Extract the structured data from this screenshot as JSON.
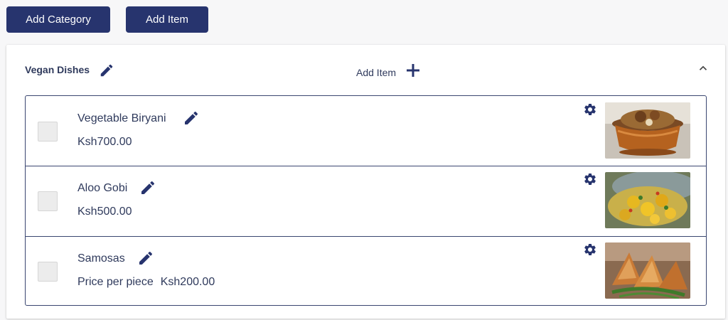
{
  "toolbar": {
    "add_category_label": "Add Category",
    "add_item_label": "Add Item"
  },
  "category": {
    "title": "Vegan Dishes",
    "add_item_label": "Add Item"
  },
  "items": [
    {
      "name": "Vegetable Biryani",
      "price_prefix": "",
      "price": "Ksh700.00",
      "image": "vegetable-biryani-photo"
    },
    {
      "name": "Aloo Gobi",
      "price_prefix": "",
      "price": "Ksh500.00",
      "image": "aloo-gobi-photo"
    },
    {
      "name": "Samosas",
      "price_prefix": "Price per piece",
      "price": "Ksh200.00",
      "image": "samosas-photo"
    }
  ],
  "colors": {
    "accent": "#27346e",
    "text": "#2f3a5c",
    "border": "#3a4670"
  },
  "icons": [
    "pencil-icon",
    "plus-icon",
    "chevron-up-icon",
    "gear-icon"
  ]
}
